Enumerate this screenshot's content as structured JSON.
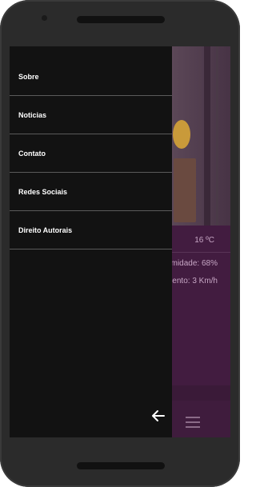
{
  "drawer": {
    "items": [
      {
        "label": "Sobre"
      },
      {
        "label": "Noticias"
      },
      {
        "label": "Contato"
      },
      {
        "label": "Redes Sociais"
      },
      {
        "label": "Direito Autorais"
      }
    ]
  },
  "weather": {
    "temperature": "16 ºC",
    "humidity": "midade: 68%",
    "wind": "ento: 3 Km/h"
  },
  "icons": {
    "back": "arrow-left-icon",
    "menu": "hamburger-menu-icon"
  },
  "colors": {
    "drawer_bg": "#121212",
    "app_bg": "#421c40",
    "divider": "#5a5a5a"
  }
}
